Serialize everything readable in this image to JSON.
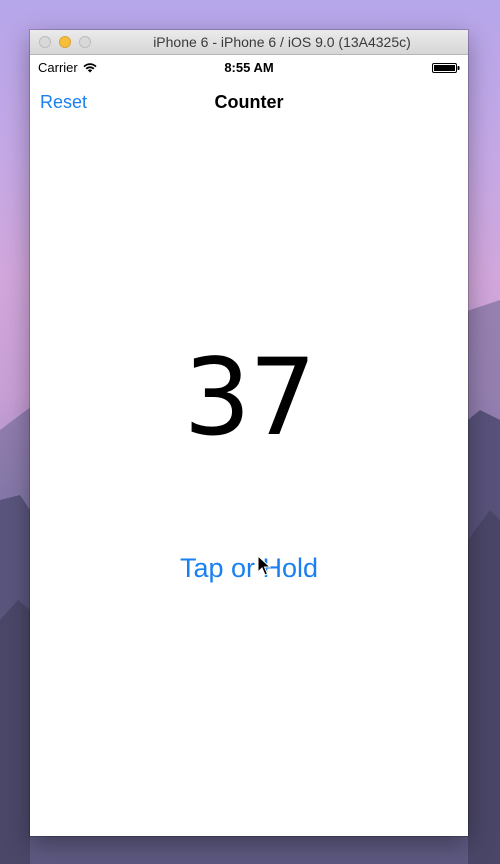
{
  "window": {
    "title": "iPhone 6 - iPhone 6 / iOS 9.0 (13A4325c)"
  },
  "status_bar": {
    "carrier": "Carrier",
    "time": "8:55 AM"
  },
  "nav_bar": {
    "left_button": "Reset",
    "title": "Counter"
  },
  "main": {
    "count": "37",
    "action_label": "Tap or Hold"
  },
  "colors": {
    "tint": "#1a7ff0",
    "window_chrome": "#e0e0e0",
    "minimize_light": "#f5bf3c"
  },
  "icons": {
    "wifi": "wifi-icon",
    "battery": "battery-icon",
    "cursor": "mouse-pointer-icon"
  }
}
